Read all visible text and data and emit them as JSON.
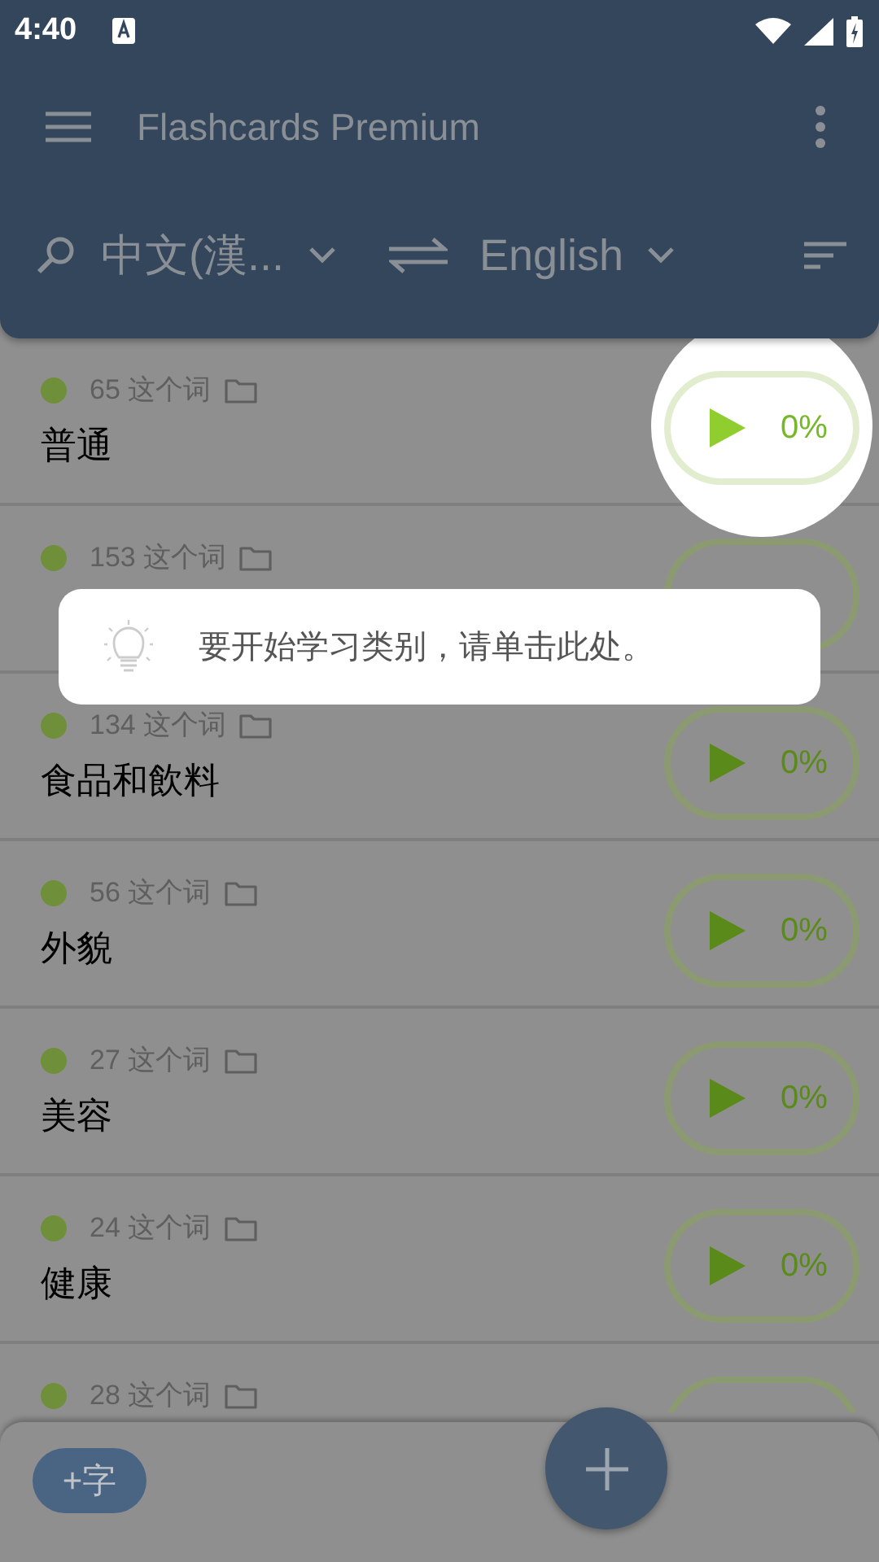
{
  "status_bar": {
    "time": "4:40"
  },
  "toolbar": {
    "title": "Flashcards Premium"
  },
  "language_bar": {
    "source": "中文(漢...",
    "target": "English"
  },
  "categories": [
    {
      "count": "65 这个词",
      "title": "普通",
      "progress": "0%",
      "highlighted": true
    },
    {
      "count": "153 这个词",
      "highlighted": false
    },
    {
      "count": "134 这个词",
      "title": "食品和飲料",
      "progress": "0%",
      "highlighted": false
    },
    {
      "count": "56 这个词",
      "title": "外貌",
      "progress": "0%",
      "highlighted": false
    },
    {
      "count": "27 这个词",
      "title": "美容",
      "progress": "0%",
      "highlighted": false
    },
    {
      "count": "24 这个词",
      "title": "健康",
      "progress": "0%",
      "highlighted": false
    },
    {
      "count": "28 这个词",
      "highlighted": false
    }
  ],
  "tooltip": {
    "text": "要开始学习类别，请单击此处。"
  },
  "bottom_bar": {
    "add_word": "+字"
  }
}
